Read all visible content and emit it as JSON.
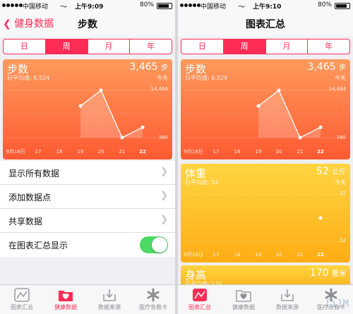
{
  "status_left": {
    "carrier": "中国移动",
    "wifi": "〜",
    "time": "上午9:09",
    "battery_pct": "80%"
  },
  "status_right": {
    "carrier": "中国移动",
    "wifi": "〜",
    "time": "上午9:10",
    "battery_pct": "80%"
  },
  "nav_left": {
    "back_label": "健身数据",
    "title": "步数"
  },
  "nav_right": {
    "title": "图表汇总"
  },
  "segments": [
    "日",
    "周",
    "月",
    "年"
  ],
  "active_segment": 1,
  "steps_card": {
    "title": "步数",
    "subtitle": "日平均值: 6,524",
    "value": "3,465",
    "unit": "步",
    "unit_right": "今天",
    "ymax_label": "14,464",
    "ymin_label": "380",
    "x_labels": [
      "9月16日",
      "17",
      "18",
      "19",
      "20",
      "21",
      "22"
    ]
  },
  "weight_card": {
    "title": "体重",
    "subtitle": "日平均值: 52",
    "value": "52",
    "unit": "公斤",
    "unit_right": "今天",
    "ymax_label": "52",
    "ymin_label": "52",
    "x_labels": [
      "9月16日",
      "17",
      "18",
      "19",
      "20",
      "21",
      "22"
    ]
  },
  "height_card": {
    "title": "身高",
    "subtitle": "日平均值: 170",
    "value": "170",
    "unit": "厘米"
  },
  "list_items": [
    {
      "label": "显示所有数据",
      "kind": "chevron"
    },
    {
      "label": "添加数据点",
      "kind": "chevron"
    },
    {
      "label": "共享数据",
      "kind": "chevron"
    },
    {
      "label": "在图表汇总显示",
      "kind": "toggle",
      "on": true
    }
  ],
  "tabs": [
    {
      "label": "图表汇总",
      "icon": "chart-icon"
    },
    {
      "label": "健康数据",
      "icon": "heart-folder-icon"
    },
    {
      "label": "数据来源",
      "icon": "download-icon"
    },
    {
      "label": "医疗急救卡",
      "icon": "medical-star-icon"
    }
  ],
  "left_active_tab": 1,
  "right_active_tab": 0,
  "colors": {
    "accent": "#ff2d55",
    "steps": "#ff5a32",
    "weight": "#ffad14",
    "toggle_on": "#4cd964"
  },
  "chart_data": [
    {
      "type": "line",
      "title": "步数",
      "x": [
        "9月16日",
        "17",
        "18",
        "19",
        "20",
        "21",
        "22"
      ],
      "series": [
        {
          "values": [
            null,
            null,
            null,
            9800,
            14464,
            380,
            3465
          ]
        }
      ],
      "ylim": [
        380,
        14464
      ]
    },
    {
      "type": "scatter",
      "title": "体重",
      "x": [
        "9月16日",
        "17",
        "18",
        "19",
        "20",
        "21",
        "22"
      ],
      "series": [
        {
          "values": [
            null,
            null,
            null,
            null,
            null,
            null,
            52
          ]
        }
      ],
      "ylim": [
        52,
        52
      ]
    }
  ],
  "watermark": "[i]M"
}
